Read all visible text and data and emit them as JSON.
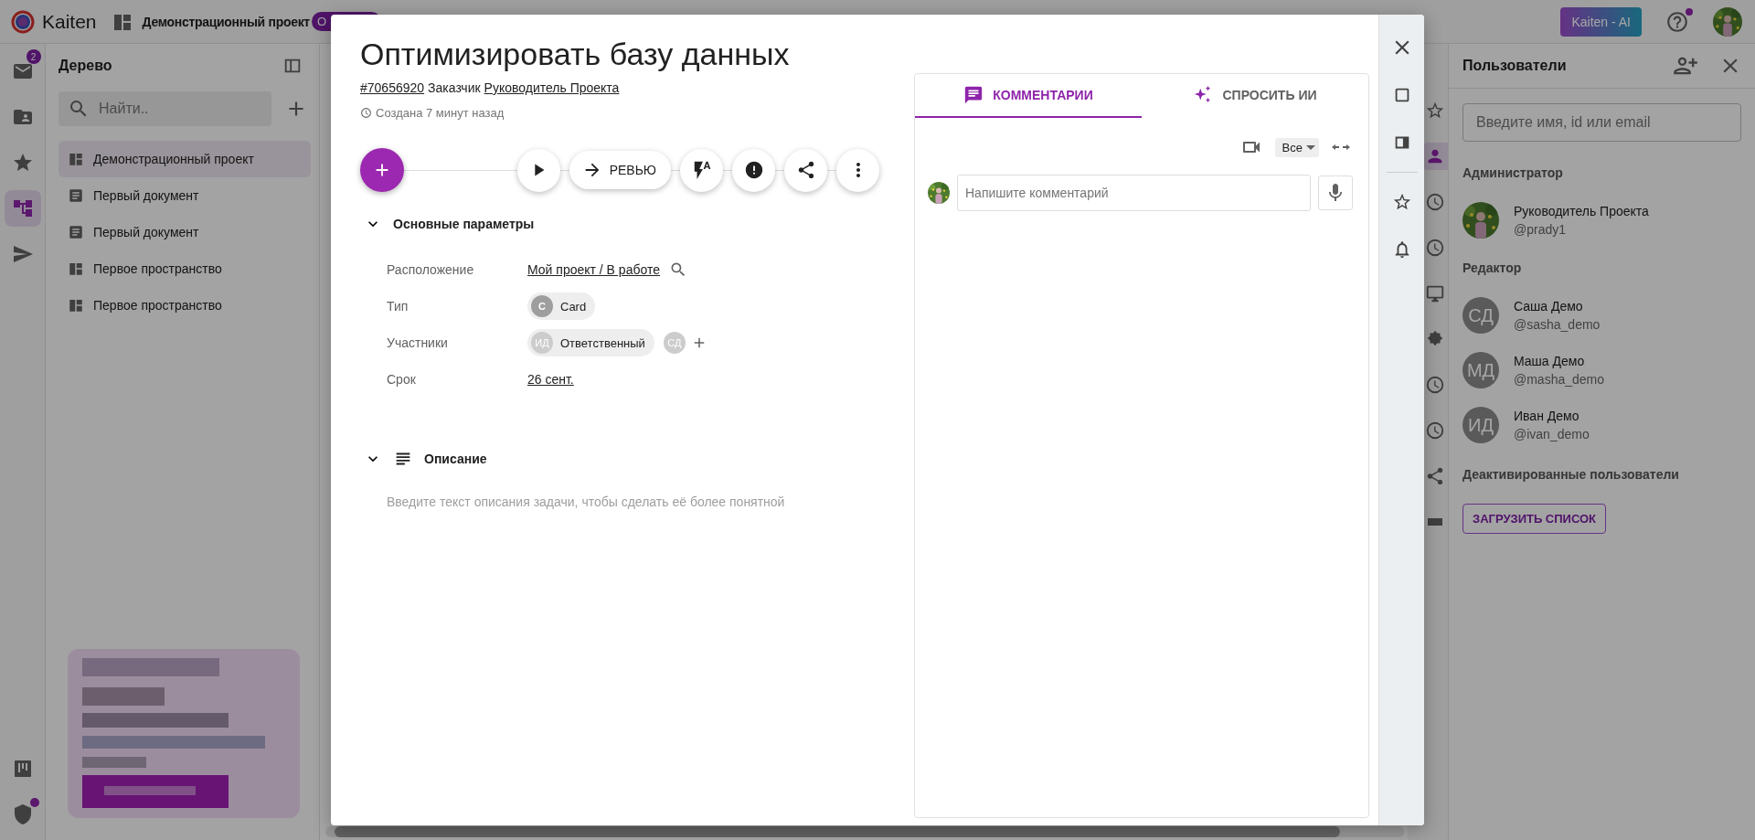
{
  "top_bar": {
    "logo_text": "Kaiten",
    "project": "Демонстрационный проект",
    "project_badge": "О",
    "ai_button": "Kaiten - AI",
    "help_dot": true
  },
  "nav_rail": {
    "items": [
      {
        "kind": "inbox",
        "badge": "2",
        "selected": false
      },
      {
        "kind": "folder",
        "selected": false
      },
      {
        "kind": "star",
        "selected": false
      },
      {
        "kind": "tree",
        "selected": true
      },
      {
        "kind": "send",
        "selected": false
      }
    ],
    "bottom": [
      {
        "kind": "board",
        "dot": false
      },
      {
        "kind": "shield",
        "dot": true
      }
    ]
  },
  "tree": {
    "title": "Дерево",
    "search_placeholder": "Найти..",
    "items": [
      {
        "kind": "space",
        "label": "Демонстрационный проект",
        "selected": true
      },
      {
        "kind": "document",
        "label": "Первый документ",
        "selected": false
      },
      {
        "kind": "document",
        "label": "Первый документ",
        "selected": false
      },
      {
        "kind": "space",
        "label": "Первое пространство",
        "selected": false
      },
      {
        "kind": "space",
        "label": "Первое пространство",
        "selected": false
      }
    ]
  },
  "side_rail": [
    {
      "kind": "star",
      "selected": false
    },
    {
      "kind": "users",
      "selected": true
    },
    {
      "kind": "clock",
      "selected": false
    },
    {
      "kind": "clock",
      "selected": false
    },
    {
      "kind": "monitor",
      "selected": false
    },
    {
      "kind": "gear",
      "selected": false
    },
    {
      "kind": "clock",
      "selected": false
    },
    {
      "kind": "clock",
      "selected": false
    },
    {
      "kind": "share",
      "selected": false
    },
    {
      "kind": "square",
      "selected": false
    }
  ],
  "card": {
    "title": "Оптимизировать базу данных",
    "id": "#70656920",
    "customer_label": "Заказчик",
    "customer": "Руководитель Проекта",
    "created": "Создана 7 минут назад",
    "actions": [
      {
        "kind": "play"
      },
      {
        "kind": "move",
        "label": "РЕВЬЮ"
      },
      {
        "kind": "automation"
      },
      {
        "kind": "alert"
      },
      {
        "kind": "share"
      },
      {
        "kind": "more"
      }
    ],
    "main_section": {
      "title": "Основные параметры",
      "expanded": true
    },
    "params": [
      {
        "kind": "location",
        "label": "Расположение",
        "value": "Мой проект / В работе"
      },
      {
        "kind": "type",
        "label": "Тип",
        "letter": "С",
        "value": "Card"
      },
      {
        "kind": "members",
        "label": "Участники",
        "initials": "ИД",
        "value": "Ответственный",
        "extra_initials": "СД"
      },
      {
        "kind": "date",
        "label": "Срок",
        "value": "26 сент."
      }
    ],
    "description": {
      "title": "Описание",
      "expanded": true,
      "placeholder": "Введите текст описания задачи, чтобы сделать её более понятной"
    }
  },
  "comments": {
    "tabs": [
      {
        "kind": "comments",
        "label": "КОММЕНТАРИИ",
        "selected": true
      },
      {
        "kind": "ai",
        "label": "СПРОСИТЬ ИИ",
        "selected": false
      }
    ],
    "filter": "Все",
    "placeholder": "Напишите комментарий"
  },
  "card_rail": [
    {
      "kind": "close"
    },
    {
      "kind": "fullscreen"
    },
    {
      "kind": "side"
    },
    {
      "kind": "divider"
    },
    {
      "kind": "star"
    },
    {
      "kind": "bell"
    }
  ],
  "users_panel": {
    "title": "Пользователи",
    "search_placeholder": "Введите имя, id или email",
    "groups": [
      {
        "title": "Администратор",
        "users": [
          {
            "name": "Руководитель Проекта",
            "handle": "@prady1"
          }
        ]
      },
      {
        "title": "Редактор",
        "users": [
          {
            "kind": "initials",
            "initials": "СД",
            "name": "Саша Демо",
            "handle": "@sasha_demo"
          },
          {
            "kind": "initials",
            "initials": "МД",
            "name": "Маша Демо",
            "handle": "@masha_demo"
          },
          {
            "kind": "initials",
            "initials": "ИД",
            "name": "Иван Демо",
            "handle": "@ivan_demo"
          }
        ]
      }
    ],
    "deactivated": "Деактивированные пользователи",
    "load_button": "ЗАГРУЗИТЬ СПИСОК"
  }
}
